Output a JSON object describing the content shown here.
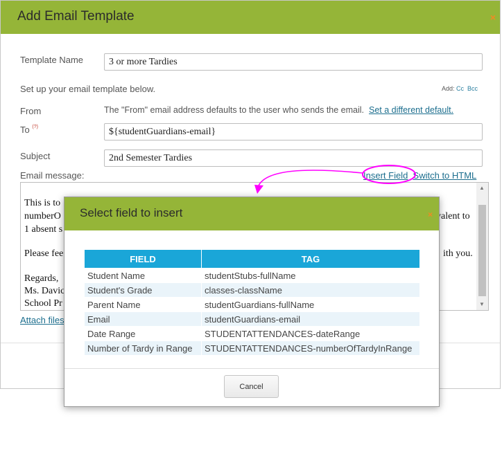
{
  "dialog": {
    "title": "Add Email Template",
    "close_glyph": "×",
    "template_name_label": "Template Name",
    "template_name_value": "3 or more Tardies",
    "setup_text": "Set up your email template below.",
    "add_label": "Add:",
    "cc_label": "Cc",
    "bcc_label": "Bcc",
    "from_label": "From",
    "from_text": "The \"From\" email address defaults to the user who sends the email.",
    "from_link": "Set a different default.",
    "to_label": "To",
    "to_help": "(?)",
    "to_value": "${studentGuardians-email}",
    "subject_label": "Subject",
    "subject_value": "2nd Semester Tardies",
    "message_label": "Email message:",
    "insert_field_link": "Insert Field",
    "switch_html_link": "Switch to HTML",
    "attach_link": "Attach files",
    "message_lines": {
      "line1": "This is to",
      "line2": "numberO",
      "line2_right": "valent to",
      "line3": "1 absent s",
      "line4": "Please fee",
      "line4_right": "ith you.",
      "line5": "Regards,",
      "line6": "Ms. Davic",
      "line7": "School Pr"
    }
  },
  "modal": {
    "title": "Select field to insert",
    "close_glyph": "×",
    "headers": {
      "field": "FIELD",
      "tag": "TAG"
    },
    "rows": [
      {
        "field": "Student Name",
        "tag": "studentStubs-fullName"
      },
      {
        "field": "Student's Grade",
        "tag": "classes-className"
      },
      {
        "field": "Parent Name",
        "tag": "studentGuardians-fullName"
      },
      {
        "field": "Email",
        "tag": "studentGuardians-email"
      },
      {
        "field": "Date Range",
        "tag": "STUDENTATTENDANCES-dateRange"
      },
      {
        "field": "Number of Tardy in Range",
        "tag": "STUDENTATTENDANCES-numberOfTardyInRange"
      }
    ],
    "cancel_label": "Cancel"
  },
  "colors": {
    "header_green": "#95b538",
    "close_orange": "#f08a24",
    "table_header_blue": "#1aa6d8",
    "annotation_magenta": "#ff00ff",
    "link_teal": "#1c6e8e"
  }
}
